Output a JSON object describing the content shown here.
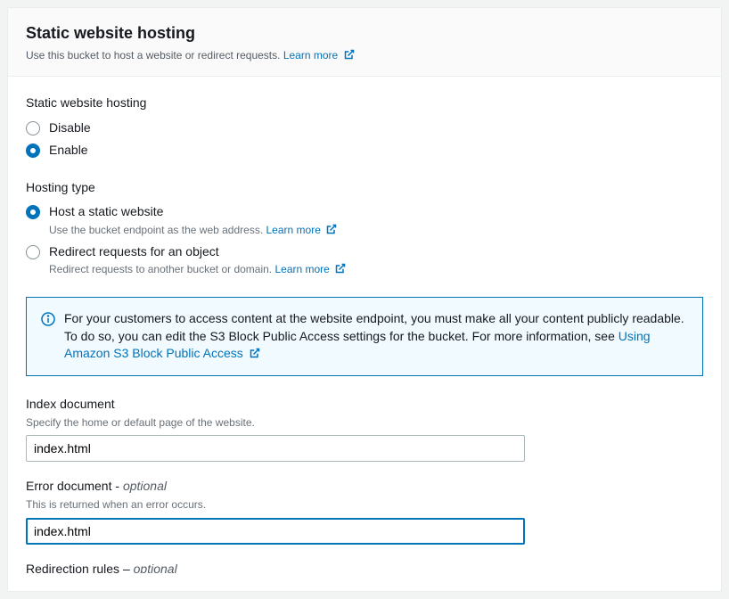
{
  "header": {
    "title": "Static website hosting",
    "subtitle": "Use this bucket to host a website or redirect requests.",
    "learn_more": "Learn more"
  },
  "hosting_toggle": {
    "label": "Static website hosting",
    "disable": "Disable",
    "enable": "Enable"
  },
  "hosting_type": {
    "label": "Hosting type",
    "host_static": {
      "label": "Host a static website",
      "desc": "Use the bucket endpoint as the web address.",
      "learn_more": "Learn more"
    },
    "redirect": {
      "label": "Redirect requests for an object",
      "desc": "Redirect requests to another bucket or domain.",
      "learn_more": "Learn more"
    }
  },
  "info_box": {
    "text_a": "For your customers to access content at the website endpoint, you must make all your content publicly readable. To do so, you can edit the S3 Block Public Access settings for the bucket. For more information, see ",
    "link": "Using Amazon S3 Block Public Access"
  },
  "index_doc": {
    "label": "Index document",
    "desc": "Specify the home or default page of the website.",
    "value": "index.html"
  },
  "error_doc": {
    "label_a": "Error document",
    "label_sep": " - ",
    "label_b": "optional",
    "desc": "This is returned when an error occurs.",
    "value": "index.html"
  },
  "redirection_rules": {
    "label_a": "Redirection rules",
    "label_sep": " – ",
    "label_b": "optional"
  }
}
